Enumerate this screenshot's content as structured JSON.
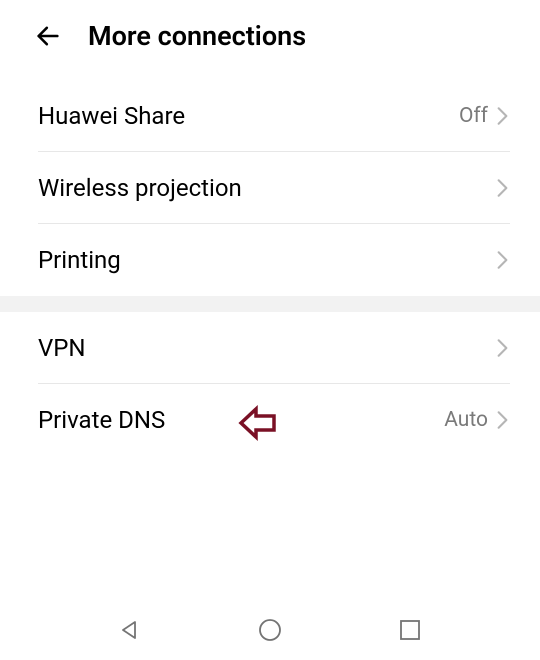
{
  "header": {
    "title": "More connections"
  },
  "sections": [
    {
      "items": [
        {
          "label": "Huawei Share",
          "value": "Off"
        },
        {
          "label": "Wireless projection",
          "value": ""
        },
        {
          "label": "Printing",
          "value": ""
        }
      ]
    },
    {
      "items": [
        {
          "label": "VPN",
          "value": ""
        },
        {
          "label": "Private DNS",
          "value": "Auto"
        }
      ]
    }
  ]
}
